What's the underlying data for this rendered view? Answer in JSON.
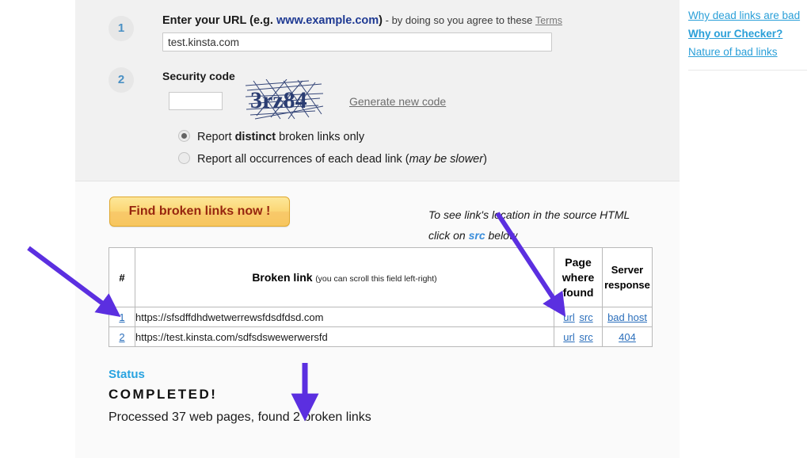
{
  "form": {
    "step1": {
      "number": "1",
      "label_bold": "Enter your URL (e.g. ",
      "label_example": "www.example.com",
      "label_close": ")",
      "label_rest": " - by doing so you agree to these ",
      "terms_link": "Terms",
      "url_value": "test.kinsta.com"
    },
    "step2": {
      "number": "2",
      "label": "Security code",
      "captcha_value": "",
      "captcha_text": "3rz84",
      "generate_link": "Generate new code",
      "radio_distinct": {
        "pre": "Report ",
        "bold": "distinct",
        "post": " broken links only",
        "checked": true
      },
      "radio_all": {
        "pre": "Report all occurrences of each dead link (",
        "italic": "may be slower",
        "post": ")",
        "checked": false
      }
    }
  },
  "results": {
    "find_button": "Find broken links now !",
    "src_hint_line1": "To see link's location in the source HTML",
    "src_hint_line2_pre": "click on ",
    "src_hint_src": "src",
    "src_hint_line2_post": " below",
    "table": {
      "headers": {
        "num": "#",
        "link_main": "Broken link",
        "link_sub": "(you can scroll this field left-right)",
        "page_where_found": [
          "Page",
          "where",
          "found"
        ],
        "server_response": [
          "Server",
          "response"
        ]
      },
      "rows": [
        {
          "num": "1",
          "link": "https://sfsdffdhdwetwerrewsfdsdfdsd.com",
          "url_label": "url",
          "src_label": "src",
          "response": "bad host"
        },
        {
          "num": "2",
          "link": "https://test.kinsta.com/sdfsdswewerwersfd",
          "url_label": "url",
          "src_label": "src",
          "response": "404"
        }
      ]
    },
    "status": {
      "title": "Status",
      "value": "COMPLETED!",
      "summary": "Processed 37 web pages, found 2 broken links"
    }
  },
  "sidebar": {
    "links": [
      {
        "label": "Why dead links are bad",
        "bold": false
      },
      {
        "label": "Why our Checker?",
        "bold": true
      },
      {
        "label": "Nature of bad links",
        "bold": false
      }
    ]
  },
  "colors": {
    "accent_blue": "#2a9fd8",
    "link_blue": "#2a6ebb",
    "button_amber": "#f7c65f",
    "button_text": "#97260f",
    "arrow_purple": "#5b2fe0",
    "panel_gray": "#f1f1f1"
  }
}
